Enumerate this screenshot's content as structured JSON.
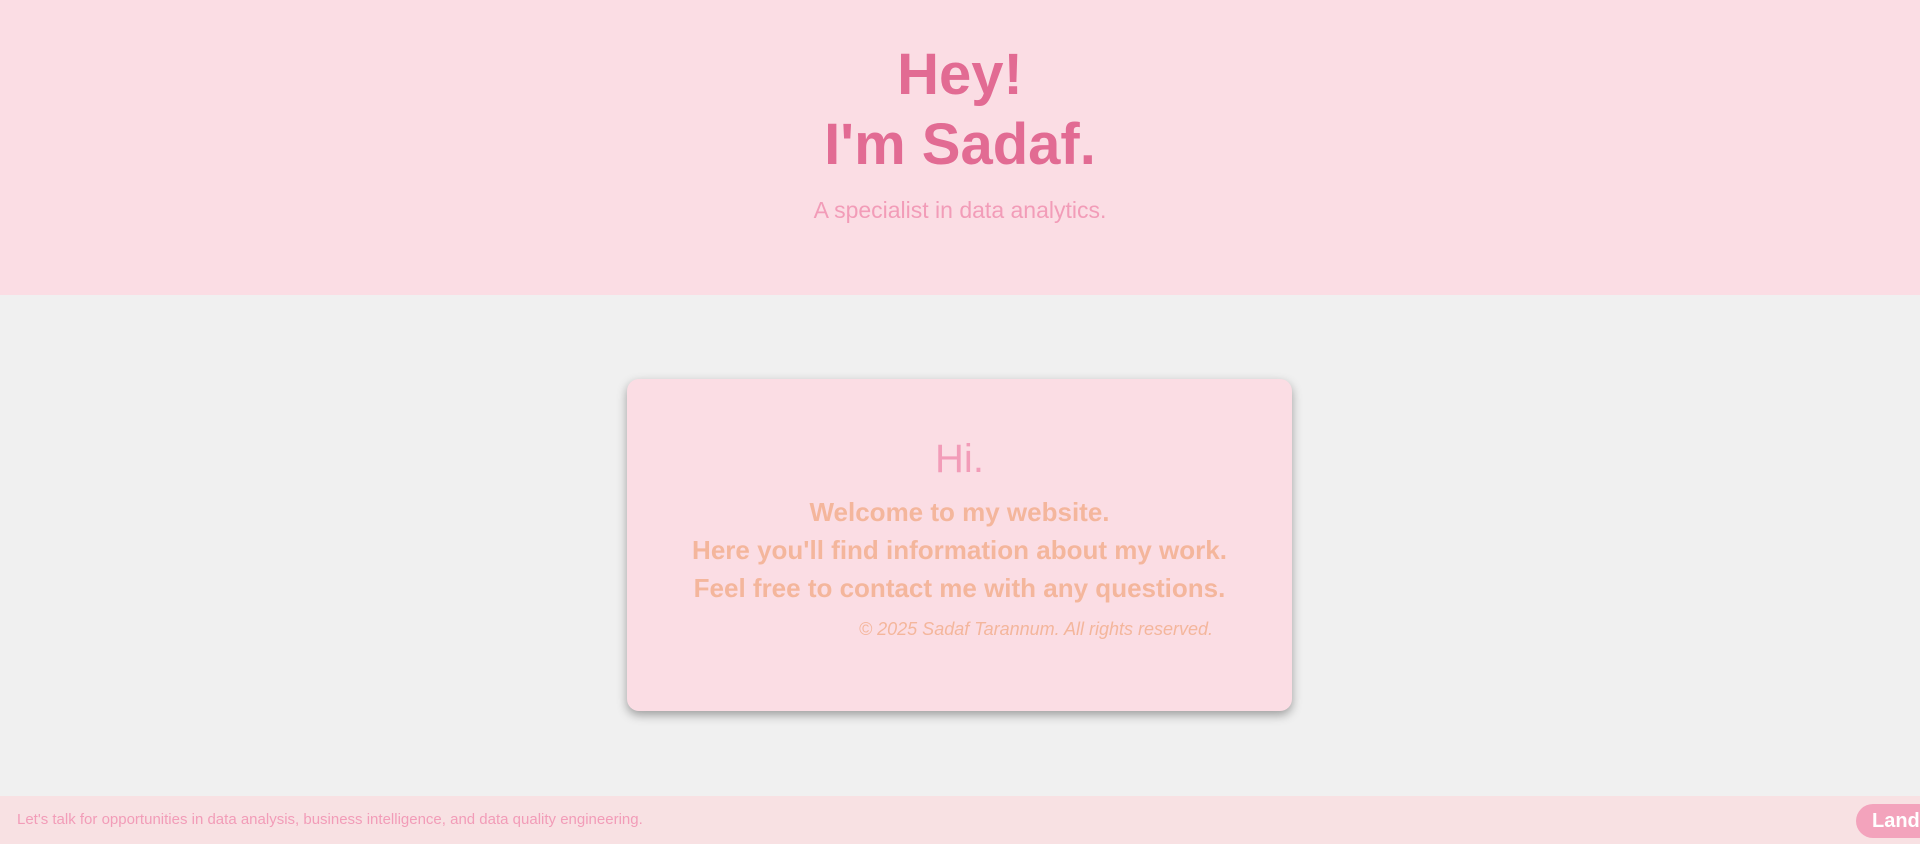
{
  "hero": {
    "title_line1": "Hey!",
    "title_line2": "I'm Sadaf.",
    "subtitle": "A specialist in data analytics."
  },
  "card": {
    "greeting": "Hi.",
    "lines": [
      "Welcome to my website.",
      "Here you'll find information about my work.",
      "Feel free to contact me with any questions."
    ],
    "copyright": "© 2025 Sadaf Tarannum. All rights reserved."
  },
  "footer": {
    "text": "Let's talk for opportunities in data analysis, business intelligence, and data quality engineering.",
    "button_label": "Land"
  },
  "colors": {
    "hero_bg": "#fbdde4",
    "page_bg": "#f0f0f0",
    "title_pink": "#e26b93",
    "subtitle_pink": "#f29cb8",
    "peach_text": "#f4b69c",
    "footer_bg": "#f8e1e3",
    "button_bg": "#f3a3bc"
  }
}
